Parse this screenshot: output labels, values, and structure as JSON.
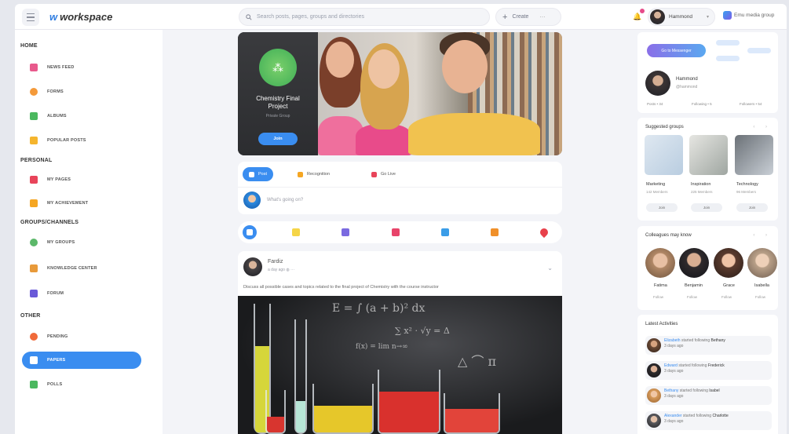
{
  "app": {
    "brand": "workspace",
    "search_placeholder": "Search posts, pages, groups and directories",
    "create_label": "Create",
    "user_name": "Hammond",
    "company_name": "Emu media group"
  },
  "sidebar": {
    "sections": [
      {
        "title": "HOME",
        "items": [
          "NEWS FEED",
          "FORMS",
          "ALBUMS",
          "POPULAR POSTS"
        ]
      },
      {
        "title": "PERSONAL",
        "items": [
          "MY PAGES",
          "MY ACHIEVEMENT"
        ]
      },
      {
        "title": "GROUPS/CHANNELS",
        "items": [
          "MY GROUPS",
          "KNOWLEDGE CENTER",
          "FORUM"
        ]
      },
      {
        "title": "OTHER",
        "items": [
          "PENDING",
          "PAPERS",
          "POLLS"
        ]
      }
    ],
    "active_item": "PAPERS"
  },
  "banner": {
    "group_title": "Chemistry Final Project",
    "group_subtitle": "Private Group",
    "join_label": "Join"
  },
  "composer": {
    "tabs": [
      "Post",
      "Recognition",
      "Go Live"
    ],
    "prompt": "What's going on?"
  },
  "post": {
    "author": "Fardiz",
    "time": "a day ago",
    "text": "Discuss all possible cases and topics related to the final project of Chemistry with the course instructor"
  },
  "right": {
    "profile": {
      "button_label": "Go to Messenger",
      "name": "Hammond",
      "handle": "@hammond",
      "stats": [
        "Posts • 34",
        "Following • 5",
        "Followers • 54"
      ]
    },
    "groups": {
      "title": "Suggested groups",
      "items": [
        {
          "name": "Marketing",
          "members": "142 Members",
          "action": "Join"
        },
        {
          "name": "Inspiration",
          "members": "225 Members",
          "action": "Join"
        },
        {
          "name": "Technology",
          "members": "96 Members",
          "action": "Join"
        }
      ]
    },
    "colleagues": {
      "title": "Colleagues may know",
      "items": [
        {
          "name": "Fatima",
          "action": "Follow"
        },
        {
          "name": "Benjamin",
          "action": "Follow"
        },
        {
          "name": "Grace",
          "action": "Follow"
        },
        {
          "name": "Isabella",
          "action": "Follow"
        }
      ]
    },
    "activities": {
      "title": "Latest Activities",
      "items": [
        {
          "actor": "Elizabeth",
          "verb": "started following",
          "target": "Bethany",
          "time": "3 days ago"
        },
        {
          "actor": "Edward",
          "verb": "started following",
          "target": "Frederick",
          "time": "3 days ago"
        },
        {
          "actor": "Bethany",
          "verb": "started following",
          "target": "Isabel",
          "time": "3 days ago"
        },
        {
          "actor": "Alexander",
          "verb": "started following",
          "target": "Charlotte",
          "time": "3 days ago"
        }
      ]
    }
  },
  "colors": {
    "accent": "#3a8df0",
    "page_bg": "#f3f4f8",
    "group_logo": "#4bb85f"
  },
  "icons": [
    "menu-icon",
    "search-icon",
    "plus-icon",
    "bell-icon",
    "chevron-down-icon"
  ]
}
